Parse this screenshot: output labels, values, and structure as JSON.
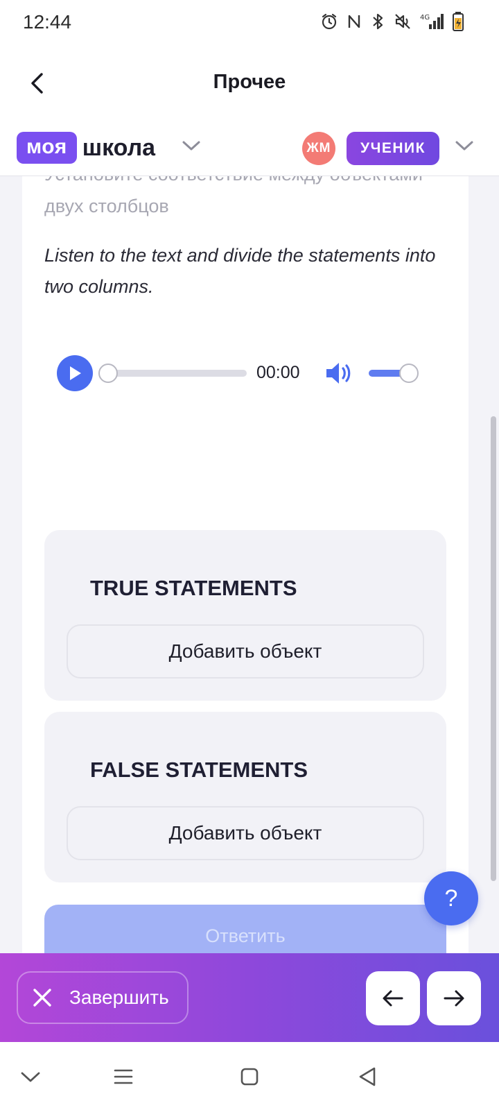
{
  "status_bar": {
    "time": "12:44",
    "icons": [
      "alarm-icon",
      "nfc-icon",
      "bluetooth-icon",
      "mute-icon",
      "signal-4g-icon",
      "battery-charging-icon"
    ],
    "network_label": "4G"
  },
  "app_bar": {
    "title": "Прочее",
    "back_icon": "chevron-left-icon"
  },
  "brand": {
    "logo_part1": "моя",
    "logo_part2": "школа",
    "accent_color": "#7a4ff0"
  },
  "user": {
    "avatar_initials": "ЖМ",
    "avatar_color": "#f37b75",
    "role": "УЧЕНИК"
  },
  "task": {
    "instruction": "Установите соответствие между объектами двух столбцов",
    "text": "Listen to the text and divide the statements into two columns."
  },
  "audio_player": {
    "time": "00:00",
    "progress": 0,
    "volume": 1.0
  },
  "columns": [
    {
      "title": "TRUE STATEMENTS",
      "add_label": "Добавить объект"
    },
    {
      "title": "FALSE STATEMENTS",
      "add_label": "Добавить объект"
    }
  ],
  "answer_button": "Ответить",
  "help_button": "?",
  "action_bar": {
    "finish_label": "Завершить",
    "prev_icon": "arrow-left-icon",
    "next_icon": "arrow-right-icon"
  },
  "system_nav": [
    "chevron-down-icon",
    "menu-icon",
    "home-square-icon",
    "back-triangle-icon"
  ]
}
